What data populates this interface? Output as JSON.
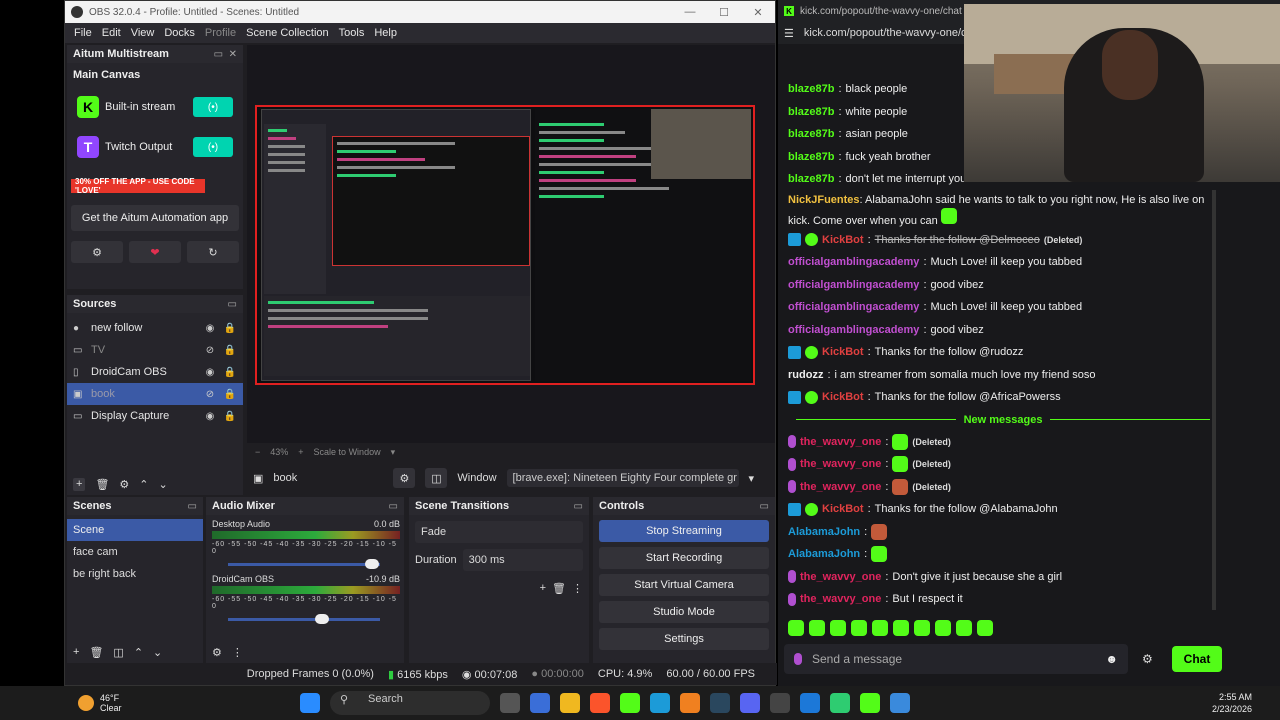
{
  "obs": {
    "title": "OBS 32.0.4 - Profile: Untitled - Scenes: Untitled",
    "menu": [
      "File",
      "Edit",
      "View",
      "Docks",
      "Profile",
      "Scene Collection",
      "Tools",
      "Help"
    ],
    "aitum": {
      "header": "Aitum Multistream",
      "canvas_label": "Main Canvas",
      "outputs": [
        {
          "name": "Built-in stream",
          "color": "#53fc18",
          "letter": "K"
        },
        {
          "name": "Twitch Output",
          "color": "#9146ff",
          "letter": "T"
        }
      ],
      "promo": "30% OFF THE APP - USE CODE 'LOVE'",
      "get_app": "Get the Aitum Automation app"
    },
    "sources": {
      "header": "Sources",
      "items": [
        {
          "name": "new follow",
          "icon": "image-icon",
          "visible": true,
          "selected": false
        },
        {
          "name": "TV",
          "icon": "display-icon",
          "visible": false,
          "selected": false
        },
        {
          "name": "DroidCam OBS",
          "icon": "camera-icon",
          "visible": true,
          "selected": false
        },
        {
          "name": "book",
          "icon": "window-icon",
          "visible": false,
          "selected": true
        },
        {
          "name": "Display Capture",
          "icon": "display-icon",
          "visible": true,
          "selected": false
        }
      ]
    },
    "zoom": {
      "percent": "43%",
      "mode": "Scale to Window"
    },
    "source_props": {
      "name": "book",
      "window_label": "Window",
      "window_value": "[brave.exe]: Nineteen Eighty Four complete gr"
    },
    "scenes": {
      "header": "Scenes",
      "items": [
        "Scene",
        "face cam",
        "be right back"
      ],
      "selected": 0
    },
    "mixer": {
      "header": "Audio Mixer",
      "channels": [
        {
          "name": "Desktop Audio",
          "db": "0.0 dB",
          "scale": "-60 -55 -50 -45 -40 -35 -30 -25 -20 -15 -10 -5 0",
          "volume": 0.95
        },
        {
          "name": "DroidCam OBS",
          "db": "-10.9 dB",
          "scale": "-60 -55 -50 -45 -40 -35 -30 -25 -20 -15 -10 -5 0",
          "volume": 0.62
        }
      ]
    },
    "transitions": {
      "header": "Scene Transitions",
      "type": "Fade",
      "duration_label": "Duration",
      "duration_value": "300 ms"
    },
    "controls": {
      "header": "Controls",
      "buttons": [
        "Stop Streaming",
        "Start Recording",
        "Start Virtual Camera",
        "Studio Mode",
        "Settings"
      ]
    },
    "status": {
      "dropped": "Dropped Frames 0 (0.0%)",
      "kbps": "6165 kbps",
      "stream_time": "00:07:08",
      "rec_time": "00:00:00",
      "cpu": "CPU: 4.9%",
      "fps": "60.00 / 60.00 FPS"
    }
  },
  "browser": {
    "tab_title": "kick.com/popout/the-wavvy-one/chat - Br",
    "url": "kick.com/popout/the-wavvy-one/c"
  },
  "chat": {
    "messages": [
      {
        "user": "blaze87b",
        "color": "#53fc18",
        "text": "black people"
      },
      {
        "user": "blaze87b",
        "color": "#53fc18",
        "text": "white people"
      },
      {
        "user": "blaze87b",
        "color": "#53fc18",
        "text": "asian people"
      },
      {
        "user": "blaze87b",
        "color": "#53fc18",
        "text": "fuck yeah brother"
      },
      {
        "user": "blaze87b",
        "color": "#53fc18",
        "text": "don't let me interrupt your s"
      }
    ],
    "nick": {
      "user": "NickJFuentes",
      "color": "#f0c040",
      "text": "AlabamaJohn said he wants to talk to you right now, He is also live on kick. Come over when you can"
    },
    "kickbot1": {
      "user": "KickBot",
      "text": "Thanks for the follow @Delmoceo",
      "deleted": "(Deleted)"
    },
    "academy": [
      {
        "user": "officialgamblingacademy",
        "text": "Much Love! ill keep you tabbed"
      },
      {
        "user": "officialgamblingacademy",
        "text": "good vibez"
      },
      {
        "user": "officialgamblingacademy",
        "text": "Much Love! ill keep you tabbed"
      },
      {
        "user": "officialgamblingacademy",
        "text": "good vibez"
      }
    ],
    "kickbot2": {
      "user": "KickBot",
      "text": "Thanks for the follow @rudozz"
    },
    "rudozz": {
      "user": "rudozz",
      "text": "i am streamer from somalia much love my friend soso"
    },
    "kickbot3": {
      "user": "KickBot",
      "text": "Thanks for the follow @AfricaPowerss"
    },
    "new_messages": "New messages",
    "wavvy_deleted": [
      {
        "user": "the_wavvy_one",
        "deleted": "(Deleted)"
      },
      {
        "user": "the_wavvy_one",
        "deleted": "(Deleted)"
      },
      {
        "user": "the_wavvy_one",
        "deleted": "(Deleted)"
      }
    ],
    "kickbot4": {
      "user": "KickBot",
      "text": "Thanks for the follow @AlabamaJohn"
    },
    "alabama": [
      {
        "user": "AlabamaJohn"
      },
      {
        "user": "AlabamaJohn"
      }
    ],
    "wavvy_msgs": [
      {
        "user": "the_wavvy_one",
        "text": "Don't give it just because she a girl"
      },
      {
        "user": "the_wavvy_one",
        "text": "But I respect it"
      }
    ],
    "colors": {
      "kickbot": "#e04040",
      "academy": "#c04fd0",
      "wavvy": "#e0245e",
      "alabama": "#1c9bd8",
      "rudozz": "#eeeeee"
    },
    "send_placeholder": "Send a message",
    "chat_button": "Chat"
  },
  "taskbar": {
    "weather_temp": "46°F",
    "weather_desc": "Clear",
    "search": "Search",
    "time": "2:55 AM",
    "date": "2/23/2026"
  }
}
